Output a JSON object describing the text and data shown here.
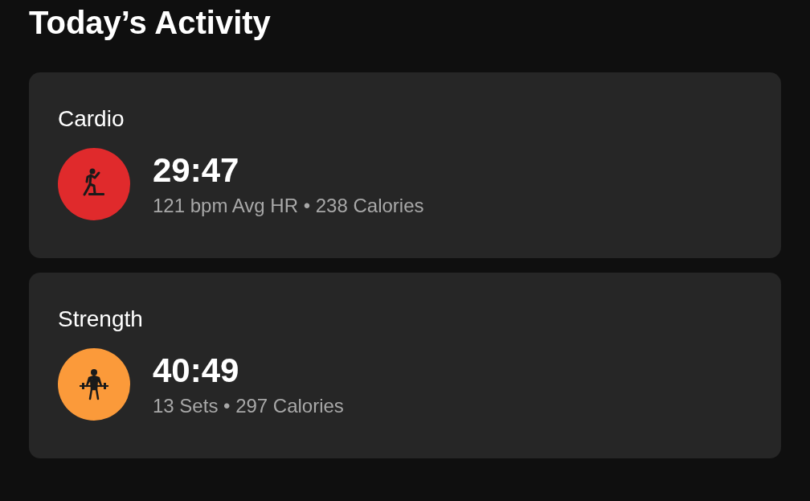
{
  "title": "Today’s Activity",
  "activities": [
    {
      "name": "Cardio",
      "kind": "cardio",
      "color": "#e02a2c",
      "duration": "29:47",
      "details": "121 bpm Avg HR • 238 Calories"
    },
    {
      "name": "Strength",
      "kind": "strength",
      "color": "#fb9a3a",
      "duration": "40:49",
      "details": "13 Sets • 297 Calories"
    }
  ]
}
